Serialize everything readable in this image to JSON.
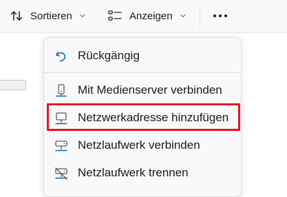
{
  "toolbar": {
    "sort_label": "Sortieren",
    "sort_icon": "sort-arrows-icon",
    "show_label": "Anzeigen",
    "show_icon": "view-list-icon",
    "more_icon": "more-ellipsis-icon"
  },
  "menu": {
    "items": [
      {
        "label": "Rückgängig",
        "icon": "undo-icon"
      },
      {
        "label": "Mit Medienserver verbinden",
        "icon": "media-server-icon"
      },
      {
        "label": "Netzwerkadresse hinzufügen",
        "icon": "network-location-icon",
        "highlighted": true
      },
      {
        "label": "Netzlaufwerk verbinden",
        "icon": "map-network-drive-icon"
      },
      {
        "label": "Netzlaufwerk trennen",
        "icon": "disconnect-network-drive-icon"
      }
    ]
  },
  "colors": {
    "accent": "#0067c0",
    "highlight_border": "#e81123",
    "menu_background": "#f9f9f9"
  }
}
